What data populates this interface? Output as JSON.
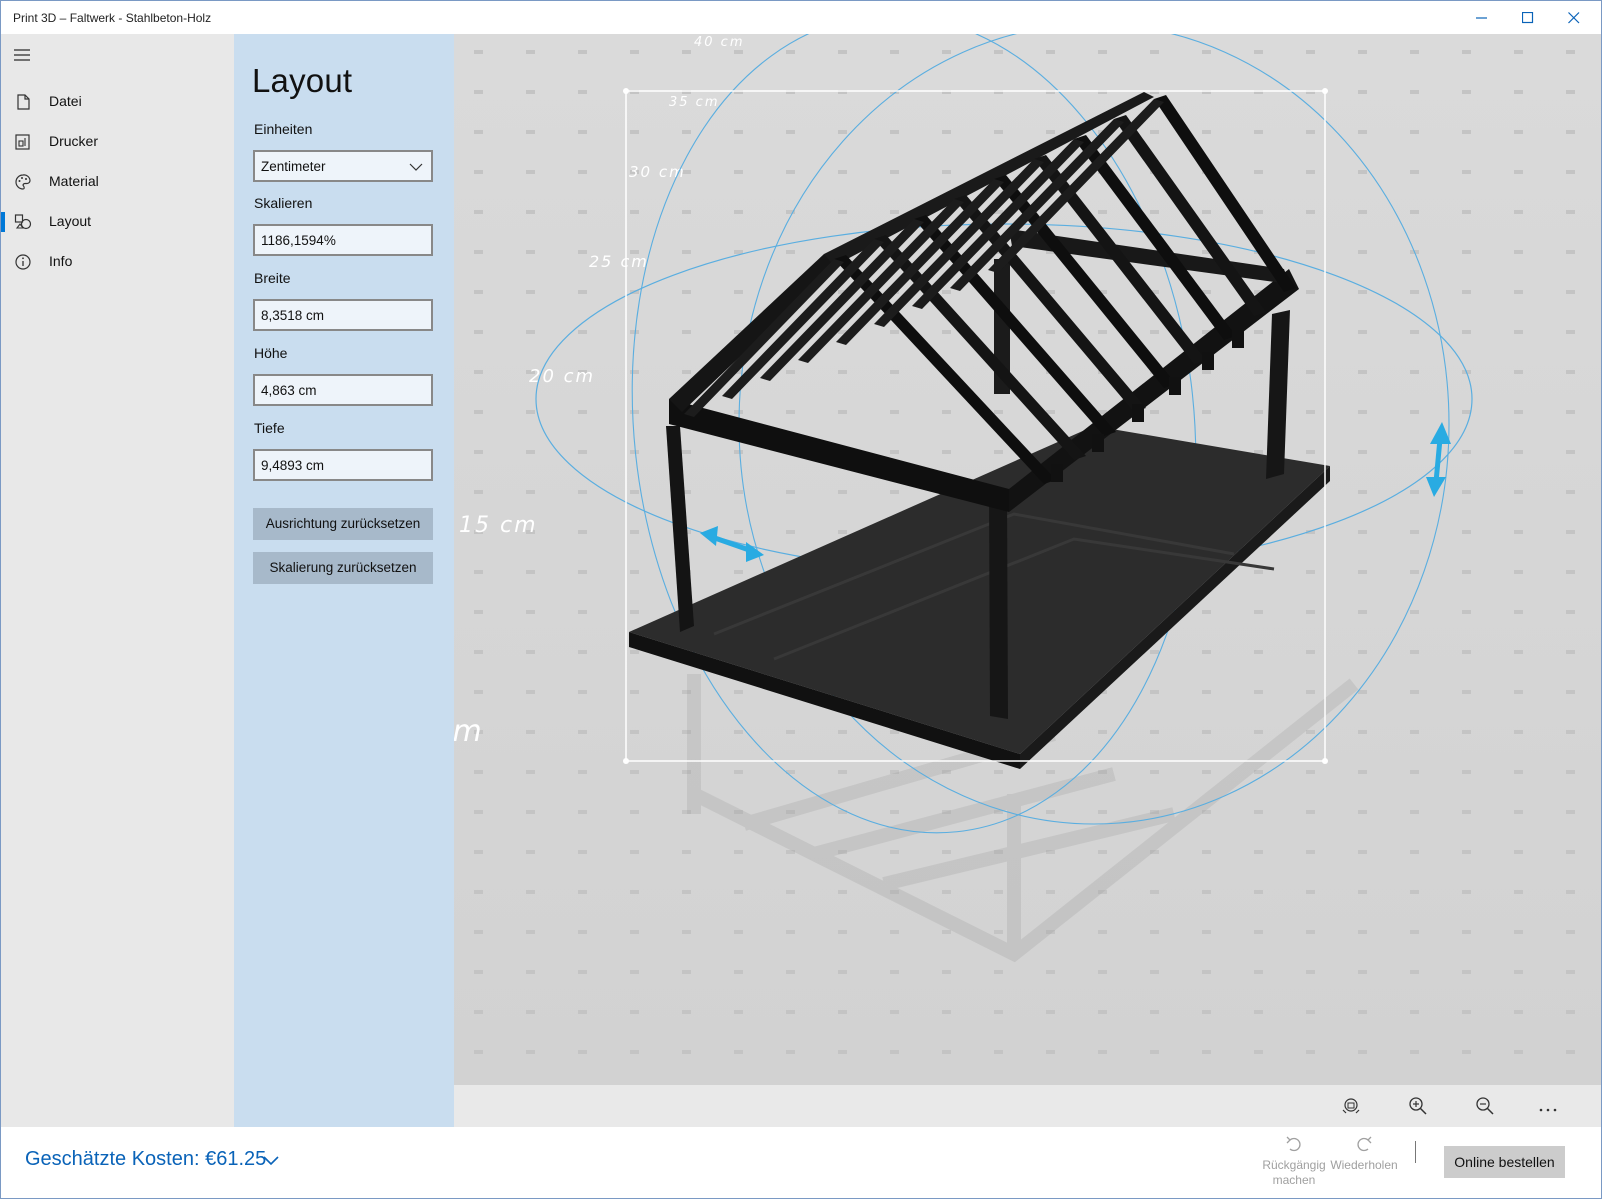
{
  "window": {
    "title": "Print 3D – Faltwerk - Stahlbeton-Holz"
  },
  "nav": {
    "items": [
      {
        "label": "Datei",
        "icon": "file-icon"
      },
      {
        "label": "Drucker",
        "icon": "printer-icon"
      },
      {
        "label": "Material",
        "icon": "palette-icon"
      },
      {
        "label": "Layout",
        "icon": "shapes-icon",
        "selected": true
      },
      {
        "label": "Info",
        "icon": "info-icon"
      }
    ]
  },
  "panel": {
    "title": "Layout",
    "units_label": "Einheiten",
    "units_value": "Zentimeter",
    "scale_label": "Skalieren",
    "scale_value": "1186,1594%",
    "width_label": "Breite",
    "width_value": "8,3518 cm",
    "height_label": "Höhe",
    "height_value": "4,863 cm",
    "depth_label": "Tiefe",
    "depth_value": "9,4893 cm",
    "reset_orientation": "Ausrichtung zurücksetzen",
    "reset_scale": "Skalierung zurücksetzen"
  },
  "viewport": {
    "ruler_labels": [
      "40 cm",
      "35 cm",
      "30 cm",
      "25 cm",
      "20 cm",
      "15 cm",
      "cm"
    ]
  },
  "footer": {
    "cost": "Geschätzte Kosten: €61.25",
    "undo_line1": "Rückgängig",
    "undo_line2": "machen",
    "redo": "Wiederholen",
    "order": "Online bestellen"
  },
  "colors": {
    "accent": "#0078d7",
    "panel_bg": "#c9ddef",
    "nav_bg": "#e8e8e8",
    "gizmo": "#29abe2",
    "cost_text": "#0a63b8"
  }
}
